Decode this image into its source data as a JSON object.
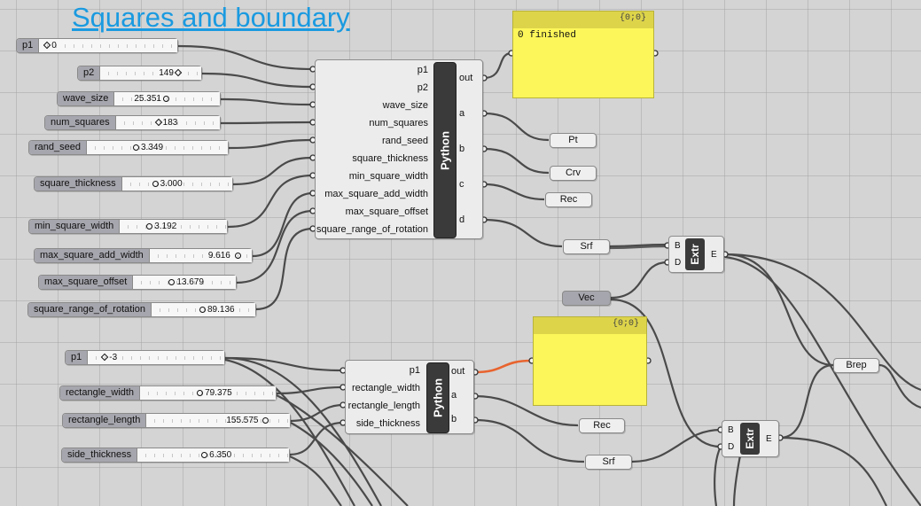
{
  "title": "Squares and boundary",
  "sliders_top": [
    {
      "label": "p1",
      "value": "0",
      "grip": "diamond"
    },
    {
      "label": "p2",
      "value": "149",
      "grip": "diamond"
    },
    {
      "label": "wave_size",
      "value": "25.351",
      "grip": "circle"
    },
    {
      "label": "num_squares",
      "value": "183",
      "grip": "diamond"
    },
    {
      "label": "rand_seed",
      "value": "3.349",
      "grip": "circle"
    },
    {
      "label": "square_thickness",
      "value": "3.000",
      "grip": "circle"
    },
    {
      "label": "min_square_width",
      "value": "3.192",
      "grip": "circle"
    },
    {
      "label": "max_square_add_width",
      "value": "9.616",
      "grip": "circle"
    },
    {
      "label": "max_square_offset",
      "value": "13.679",
      "grip": "circle"
    },
    {
      "label": "square_range_of_rotation",
      "value": "89.136",
      "grip": "circle"
    }
  ],
  "sliders_bottom": [
    {
      "label": "p1",
      "value": "-3",
      "grip": "diamond"
    },
    {
      "label": "rectangle_width",
      "value": "79.375",
      "grip": "circle"
    },
    {
      "label": "rectangle_length",
      "value": "155.575",
      "grip": "circle"
    },
    {
      "label": "side_thickness",
      "value": "6.350",
      "grip": "circle"
    }
  ],
  "python1": {
    "name": "Python",
    "inputs": [
      "p1",
      "p2",
      "wave_size",
      "num_squares",
      "rand_seed",
      "square_thickness",
      "min_square_width",
      "max_square_add_width",
      "max_square_offset",
      "square_range_of_rotation"
    ],
    "outputs": [
      "out",
      "a",
      "b",
      "c",
      "d"
    ]
  },
  "python2": {
    "name": "Python",
    "inputs": [
      "p1",
      "rectangle_width",
      "rectangle_length",
      "side_thickness"
    ],
    "outputs": [
      "out",
      "a",
      "b"
    ]
  },
  "panel1": {
    "header": "{0;0}",
    "text": "0 finished"
  },
  "panel2": {
    "header": "{0;0}",
    "text": ""
  },
  "params": {
    "pt": "Pt",
    "crv": "Crv",
    "rec1": "Rec",
    "srf1": "Srf",
    "vec": "Vec",
    "brep": "Brep",
    "rec2": "Rec",
    "srf2": "Srf"
  },
  "extr1": {
    "name": "Extr",
    "in_b": "B",
    "in_d": "D",
    "out_e": "E"
  },
  "extr2": {
    "name": "Extr",
    "in_b": "B",
    "in_d": "D",
    "out_e": "E"
  }
}
